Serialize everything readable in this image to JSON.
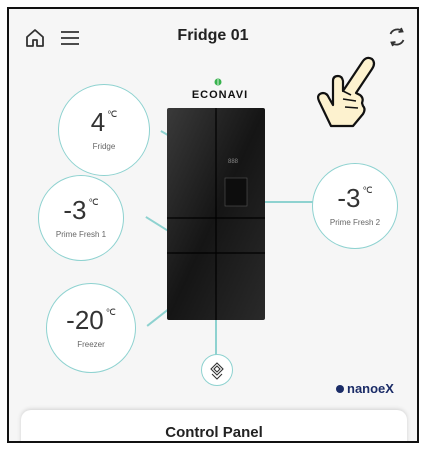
{
  "header": {
    "title": "Fridge 01",
    "home_icon": "home-icon",
    "menu_icon": "hamburger-menu-icon",
    "refresh_icon": "refresh-icon"
  },
  "brand": {
    "text": "ECONAVI"
  },
  "compartments": {
    "fridge": {
      "value": "4",
      "unit": "℃",
      "label": "Fridge"
    },
    "prime_fresh_1": {
      "value": "-3",
      "unit": "℃",
      "label": "Prime Fresh 1"
    },
    "prime_fresh_2": {
      "value": "-3",
      "unit": "℃",
      "label": "Prime Fresh 2"
    },
    "freezer": {
      "value": "-20",
      "unit": "℃",
      "label": "Freezer"
    }
  },
  "nanoe": {
    "text": "nanoeX"
  },
  "control_panel": {
    "label": "Control Panel"
  },
  "colors": {
    "accent_line": "#8ed2d0",
    "background": "#f6f6f6",
    "fridge_body": "#1b1b1b"
  }
}
